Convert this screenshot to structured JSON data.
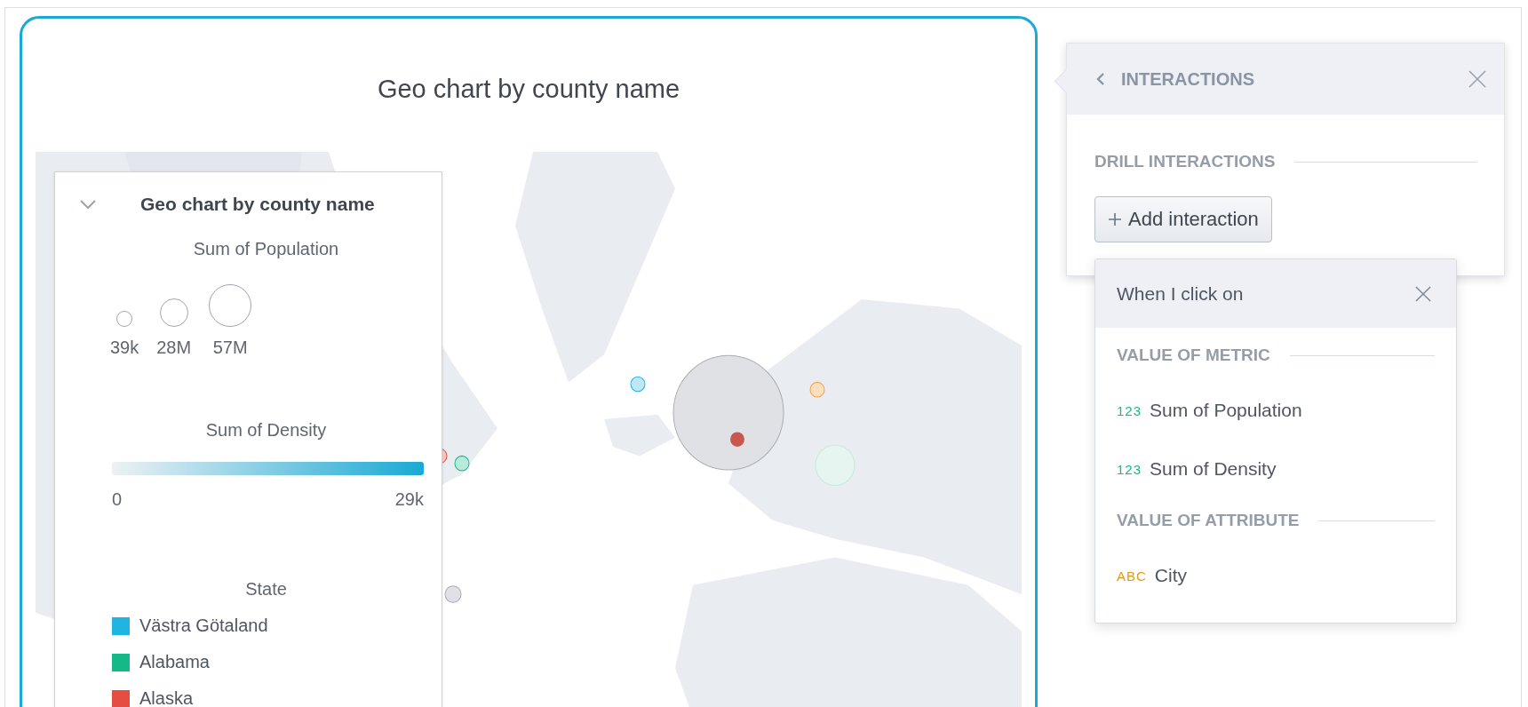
{
  "chart": {
    "title": "Geo chart by county name",
    "legend": {
      "title": "Geo chart by county name",
      "expanded": true,
      "size": {
        "title": "Sum of Population",
        "labels": [
          "39k",
          "28M",
          "57M"
        ]
      },
      "color_scale": {
        "title": "Sum of Density",
        "min": "0",
        "max": "29k"
      },
      "category": {
        "title": "State",
        "items": [
          {
            "label": "Västra Götaland",
            "color": "#1fb5e0"
          },
          {
            "label": "Alabama",
            "color": "#14b889"
          },
          {
            "label": "Alaska",
            "color": "#e54d42"
          }
        ]
      }
    }
  },
  "interactions_panel": {
    "title": "INTERACTIONS",
    "section": "DRILL INTERACTIONS",
    "add_button": "Add interaction",
    "dropdown": {
      "title": "When I click on",
      "groups": [
        {
          "heading": "VALUE OF METRIC",
          "items": [
            {
              "kind": "metric",
              "badge": "123",
              "label": "Sum of Population"
            },
            {
              "kind": "metric",
              "badge": "123",
              "label": "Sum of Density"
            }
          ]
        },
        {
          "heading": "VALUE OF ATTRIBUTE",
          "items": [
            {
              "kind": "attribute",
              "badge": "ABC",
              "label": "City"
            }
          ]
        }
      ]
    }
  }
}
